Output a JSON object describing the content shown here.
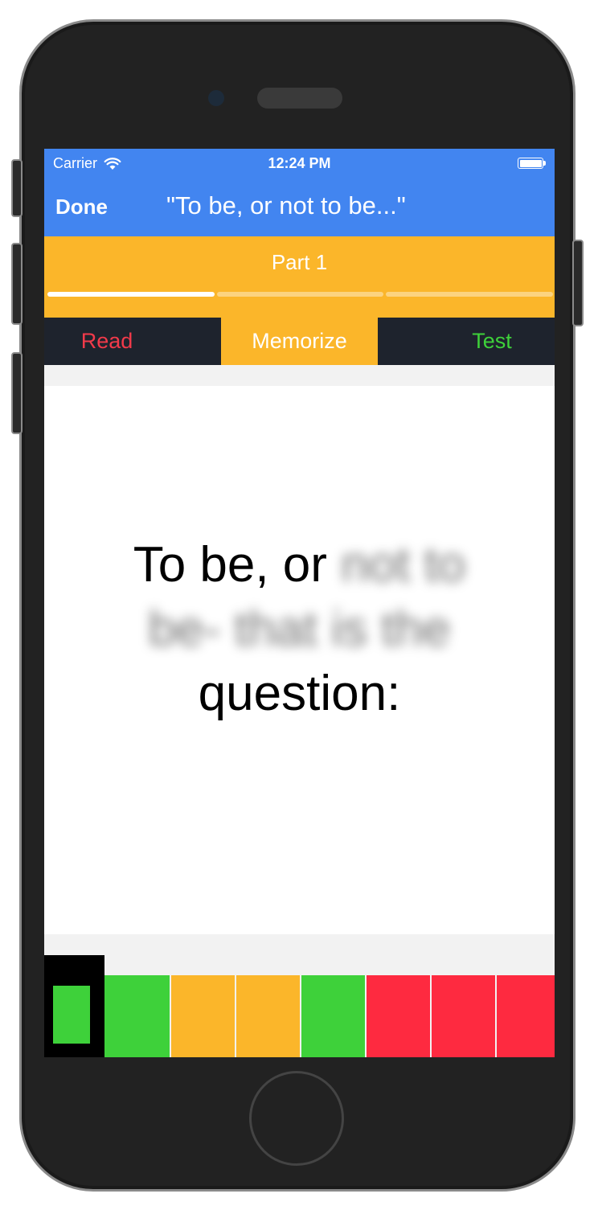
{
  "status_bar": {
    "carrier": "Carrier",
    "time": "12:24 PM",
    "wifi_icon": "wifi-icon",
    "battery_icon": "battery-icon",
    "battery_level": 1.0
  },
  "nav": {
    "done_label": "Done",
    "title": "\"To be, or not to be...\""
  },
  "part": {
    "title": "Part 1",
    "segments": 3,
    "active_segment": 1
  },
  "tabs": [
    {
      "label": "Read",
      "color": "#f23a4a"
    },
    {
      "label": "Memorize",
      "color": "#ffffff",
      "selected": true
    },
    {
      "label": "Test",
      "color": "#3ed13a"
    }
  ],
  "verse": {
    "line1_visible": "To be, or",
    "line1_hidden": "not to",
    "line2_hidden": "be- that is the",
    "line3_visible": "question:"
  },
  "progress_strip": {
    "selected_color": "#3ed13a",
    "cells": [
      "#3ed13a",
      "#fbb62a",
      "#fbb62a",
      "#3ed13a",
      "#fe2a40",
      "#fe2a40",
      "#fe2a40"
    ]
  },
  "colors": {
    "nav_blue": "#4285f0",
    "accent_orange": "#fbb62a",
    "tab_dark": "#1e232d",
    "green": "#3ed13a",
    "red": "#fe2a40"
  }
}
